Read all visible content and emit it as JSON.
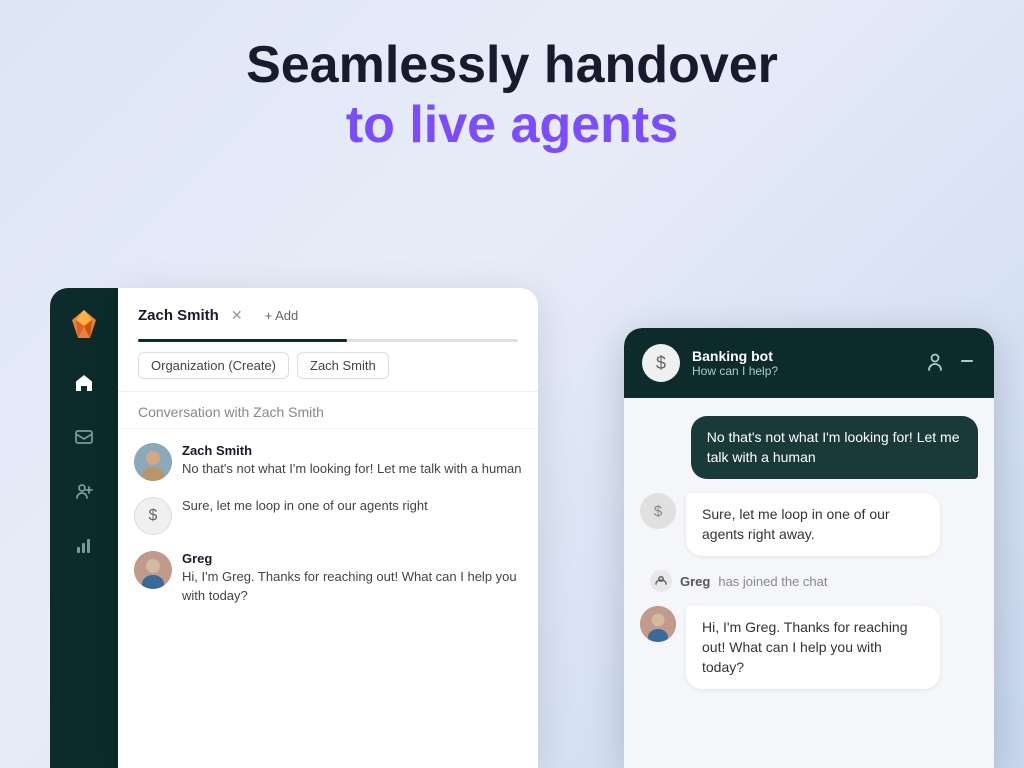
{
  "hero": {
    "line1": "Seamlessly handover",
    "line2_prefix": "to ",
    "line2_main": "live agents"
  },
  "sidebar": {
    "items": [
      {
        "name": "home",
        "icon": "⌂",
        "active": true
      },
      {
        "name": "inbox",
        "icon": "≡",
        "active": false
      },
      {
        "name": "contacts",
        "icon": "👤",
        "active": false
      },
      {
        "name": "analytics",
        "icon": "📊",
        "active": false
      }
    ]
  },
  "chat_panel": {
    "tab_name": "Zach Smith",
    "tab_add": "+ Add",
    "org_tags": [
      "Organization (Create)",
      "Zach Smith"
    ],
    "section_title": "Conversation with Zach Smith",
    "messages": [
      {
        "sender": "Zach Smith",
        "text": "No that's not what I'm looking for! Let me talk with a human"
      },
      {
        "sender": "bot",
        "text": "Sure, let me loop in one of our agents right"
      },
      {
        "sender": "Greg",
        "text": "Hi, I'm Greg. Thanks for reaching out! What can I help you with today?"
      }
    ]
  },
  "widget": {
    "header": {
      "name": "Banking bot",
      "subtitle": "How can I help?"
    },
    "messages": [
      {
        "type": "user",
        "text": "No that's not what I'm looking for! Let me talk with a human"
      },
      {
        "type": "bot",
        "text": "Sure, let me loop in one of our agents right away."
      },
      {
        "type": "join",
        "name": "Greg",
        "text": "has joined the chat"
      },
      {
        "type": "agent",
        "sender": "Greg",
        "text": "Hi, I'm Greg. Thanks for reaching out! What can I help you with today?"
      }
    ]
  }
}
